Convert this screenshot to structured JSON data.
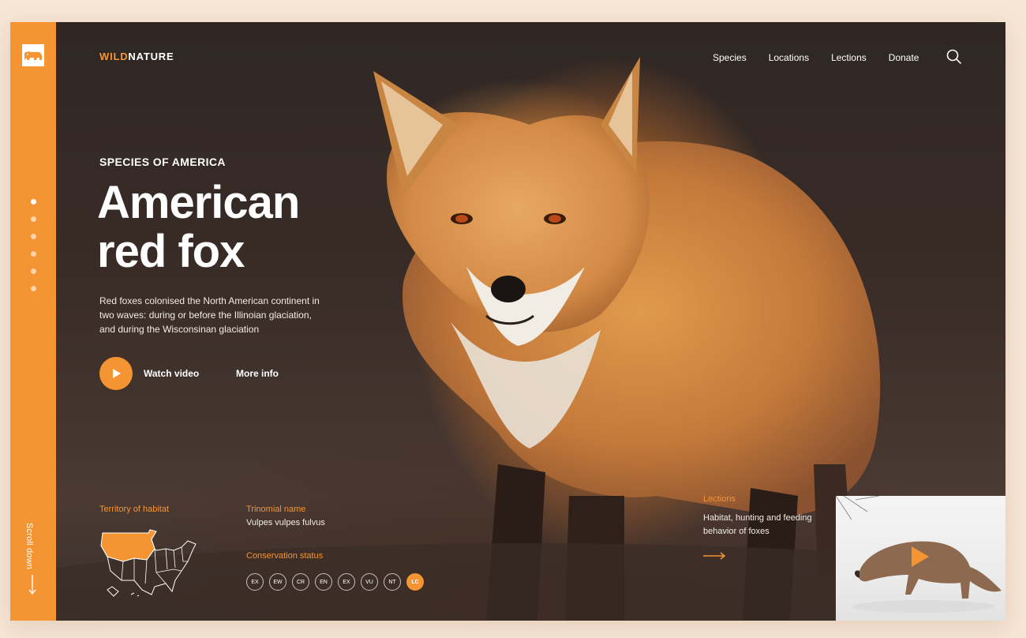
{
  "colors": {
    "accent": "#f59432",
    "background": "#f7e6d6",
    "hero_dark": "#2f2724"
  },
  "brand": {
    "part1": "WILD",
    "part2": "NATURE",
    "logo_icon": "bear-icon"
  },
  "nav": {
    "items": [
      "Species",
      "Locations",
      "Lections",
      "Donate"
    ],
    "search_icon": "search-icon"
  },
  "sidebar": {
    "dots_count": 6,
    "active_dot": 0,
    "scroll_label": "Scroll down"
  },
  "hero": {
    "eyebrow": "SPECIES OF AMERICA",
    "title_line1": "American",
    "title_line2": "red fox",
    "description": "Red foxes colonised the North American continent in two waves: during or before the Illinoian glaciation, and during the Wisconsinan glaciation",
    "watch_video": "Watch video",
    "more_info": "More info"
  },
  "info": {
    "territory_label": "Territory of habitat",
    "trinomial_label": "Trinomial name",
    "trinomial_value": "Vulpes vulpes fulvus",
    "conservation_label": "Conservation status",
    "statuses": [
      "EX",
      "EW",
      "CR",
      "EN",
      "EX",
      "VU",
      "NT",
      "LC"
    ],
    "active_status": "LC"
  },
  "lections": {
    "label": "Lections",
    "description": "Habitat, hunting and feeding behavior of foxes"
  }
}
